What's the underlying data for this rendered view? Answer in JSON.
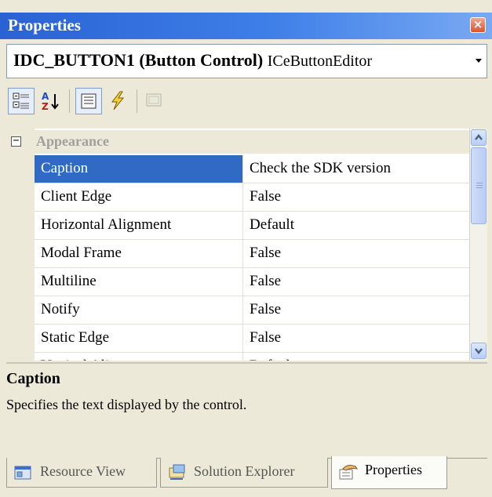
{
  "window": {
    "title": "Properties",
    "close_glyph": "×"
  },
  "object_selector": {
    "name": "IDC_BUTTON1 (Button Control)",
    "type": "ICeButtonEditor"
  },
  "toolbar": {
    "buttons": [
      {
        "icon": "categorized-icon",
        "pressed": true
      },
      {
        "icon": "alphabetical-icon",
        "pressed": false
      },
      {
        "icon": "properties-icon",
        "pressed": true
      },
      {
        "icon": "events-icon",
        "pressed": false
      },
      {
        "icon": "property-pages-icon",
        "pressed": false,
        "disabled": true
      }
    ]
  },
  "grid": {
    "category": {
      "label": "Appearance",
      "expander": "−"
    },
    "rows": [
      {
        "name": "Caption",
        "value": "Check the SDK version",
        "selected": true
      },
      {
        "name": "Client Edge",
        "value": "False"
      },
      {
        "name": "Horizontal Alignment",
        "value": "Default"
      },
      {
        "name": "Modal Frame",
        "value": "False"
      },
      {
        "name": "Multiline",
        "value": "False"
      },
      {
        "name": "Notify",
        "value": "False"
      },
      {
        "name": "Static Edge",
        "value": "False"
      },
      {
        "name": "Vertical Alignment",
        "value": "Default"
      }
    ]
  },
  "description": {
    "title": "Caption",
    "text": "Specifies the text displayed by the control."
  },
  "tabs": [
    {
      "label": "Resource View",
      "icon": "resource-view-icon",
      "active": false
    },
    {
      "label": "Solution Explorer",
      "icon": "solution-explorer-icon",
      "active": false
    },
    {
      "label": "Properties",
      "icon": "properties-hand-icon",
      "active": true
    }
  ],
  "colors": {
    "title_bar": "#3e7fe8",
    "selection": "#316ac5",
    "panel": "#ece9d8"
  }
}
